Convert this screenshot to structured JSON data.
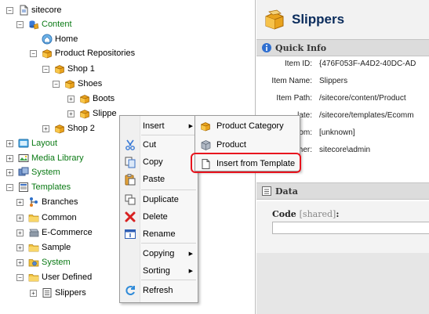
{
  "tree": {
    "items": [
      {
        "label": "sitecore",
        "icon": "document-icon",
        "expander": "−",
        "depth": 0
      },
      {
        "label": "Content",
        "icon": "content-database-icon",
        "expander": "−",
        "depth": 1,
        "color": "#0a7a14"
      },
      {
        "label": "Home",
        "icon": "home-icon",
        "expander": "",
        "depth": 2
      },
      {
        "label": "Product Repositories",
        "icon": "folder-box-icon",
        "expander": "−",
        "depth": 2
      },
      {
        "label": "Shop 1",
        "icon": "folder-box-icon",
        "expander": "−",
        "depth": 3
      },
      {
        "label": "Shoes",
        "icon": "folder-box-icon",
        "expander": "−",
        "depth": 4
      },
      {
        "label": "Boots",
        "icon": "folder-box-icon",
        "expander": "+",
        "depth": 5
      },
      {
        "label": "Slippe",
        "icon": "folder-box-icon",
        "expander": "+",
        "depth": 5
      },
      {
        "label": "Shop 2",
        "icon": "folder-box-icon",
        "expander": "+",
        "depth": 3
      },
      {
        "label": "Layout",
        "icon": "layout-icon",
        "expander": "+",
        "depth": 0,
        "color": "#0a7a14"
      },
      {
        "label": "Media Library",
        "icon": "media-library-icon",
        "expander": "+",
        "depth": 0,
        "color": "#0a7a14"
      },
      {
        "label": "System",
        "icon": "system-icon",
        "expander": "+",
        "depth": 0,
        "color": "#0a7a14"
      },
      {
        "label": "Templates",
        "icon": "templates-icon",
        "expander": "−",
        "depth": 0,
        "color": "#0a7a14"
      },
      {
        "label": "Branches",
        "icon": "branches-icon",
        "expander": "+",
        "depth": 1
      },
      {
        "label": "Common",
        "icon": "folder-icon",
        "expander": "+",
        "depth": 1
      },
      {
        "label": "E-Commerce",
        "icon": "ecommerce-icon",
        "expander": "+",
        "depth": 1
      },
      {
        "label": "Sample",
        "icon": "folder-icon",
        "expander": "+",
        "depth": 1
      },
      {
        "label": "System",
        "icon": "system-folder-icon",
        "expander": "+",
        "depth": 1,
        "color": "#0a7a14"
      },
      {
        "label": "User Defined",
        "icon": "folder-icon",
        "expander": "−",
        "depth": 1
      },
      {
        "label": "Slippers",
        "icon": "template-icon",
        "expander": "+",
        "depth": 2
      }
    ]
  },
  "context_menu": {
    "items": [
      {
        "label": "Insert",
        "icon": "",
        "has_submenu": true
      },
      {
        "label": "Cut",
        "icon": "cut-icon",
        "has_submenu": false
      },
      {
        "label": "Copy",
        "icon": "copy-icon",
        "has_submenu": false
      },
      {
        "label": "Paste",
        "icon": "paste-icon",
        "has_submenu": false
      },
      {
        "label": "Duplicate",
        "icon": "duplicate-icon",
        "has_submenu": false
      },
      {
        "label": "Delete",
        "icon": "delete-icon",
        "has_submenu": false
      },
      {
        "label": "Rename",
        "icon": "rename-icon",
        "has_submenu": false
      },
      {
        "label": "Copying",
        "icon": "",
        "has_submenu": true
      },
      {
        "label": "Sorting",
        "icon": "",
        "has_submenu": true
      },
      {
        "label": "Refresh",
        "icon": "refresh-icon",
        "has_submenu": false
      }
    ]
  },
  "insert_submenu": {
    "items": [
      {
        "label": "Product Category",
        "icon": "folder-box-icon"
      },
      {
        "label": "Product",
        "icon": "product-icon"
      },
      {
        "label": "Insert from Template",
        "icon": "page-icon"
      }
    ]
  },
  "item_panel": {
    "title": "Slippers",
    "title_icon": "folder-box-icon",
    "quick_info": {
      "heading": "Quick Info",
      "fields": [
        {
          "label": "Item ID:",
          "value": "{476F053F-A4D2-40DC-AD"
        },
        {
          "label": "Item Name:",
          "value": "Slippers"
        },
        {
          "label": "Item Path:",
          "value": "/sitecore/content/Product"
        },
        {
          "label": "late:",
          "value": "/sitecore/templates/Ecomm"
        },
        {
          "label": "rom:",
          "value": "[unknown]"
        },
        {
          "label": "her:",
          "value": "sitecore\\admin"
        }
      ]
    },
    "data_section": {
      "heading": "Data",
      "code_label": "Code",
      "code_shared": "[shared]",
      "code_suffix": ":",
      "code_value": ""
    }
  },
  "colors": {
    "accent_green": "#0a7a14",
    "highlight_red": "#e8141e",
    "title_blue": "#0a2c5c"
  }
}
